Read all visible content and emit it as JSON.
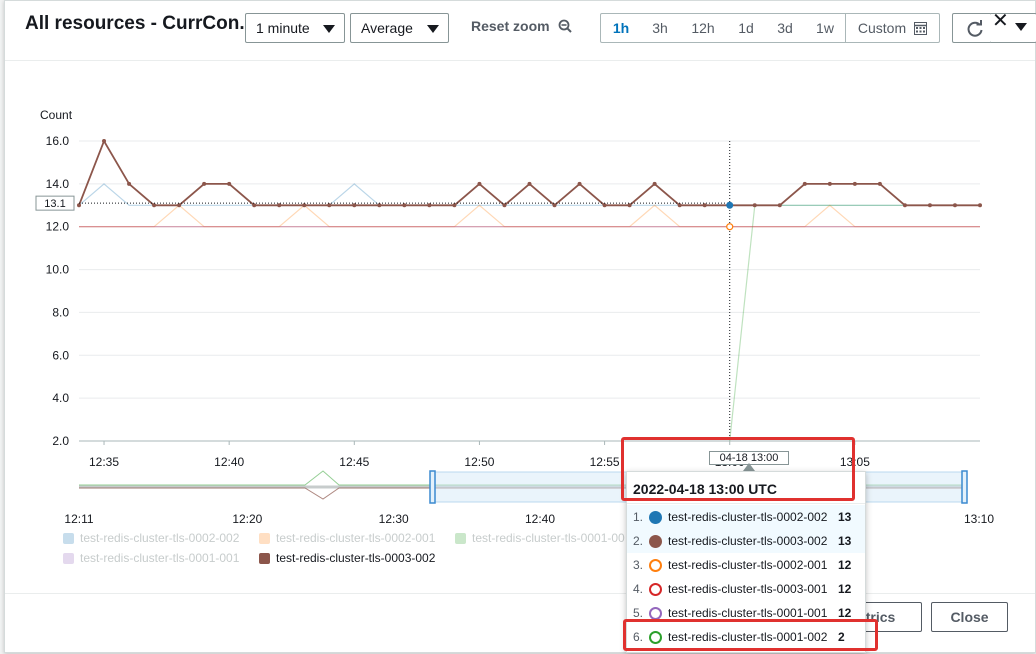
{
  "header": {
    "title": "All resources - CurrCon...",
    "period": "1 minute",
    "statistic": "Average",
    "reset_zoom": "Reset zoom",
    "ranges": [
      "1h",
      "3h",
      "12h",
      "1d",
      "3d",
      "1w"
    ],
    "selected_range": "1h",
    "custom": "Custom"
  },
  "footer": {
    "metrics_label": "trics",
    "close_label": "Close"
  },
  "legend": [
    {
      "name": "test-redis-cluster-tls-0002-002",
      "color": "#1f77b4",
      "active": false
    },
    {
      "name": "test-redis-cluster-tls-0002-001",
      "color": "#ff7f0e",
      "active": false
    },
    {
      "name": "test-redis-cluster-tls-0001-00",
      "color": "#2ca02c",
      "active": false
    },
    {
      "name": "test-redis-cluster-tls-0001-001",
      "color": "#9467bd",
      "active": false
    },
    {
      "name": "test-redis-cluster-tls-0003-002",
      "color": "#8c564b",
      "active": true
    }
  ],
  "tooltip": {
    "timestamp": "2022-04-18 13:00 UTC",
    "cursor_label": "04-18 13:00",
    "rows": [
      {
        "num": "1.",
        "name": "test-redis-cluster-tls-0002-002",
        "value": "13",
        "color": "#1f77b4",
        "filled": true
      },
      {
        "num": "2.",
        "name": "test-redis-cluster-tls-0003-002",
        "value": "13",
        "color": "#8c564b",
        "filled": true
      },
      {
        "num": "3.",
        "name": "test-redis-cluster-tls-0002-001",
        "value": "12",
        "color": "#ff7f0e",
        "filled": false
      },
      {
        "num": "4.",
        "name": "test-redis-cluster-tls-0003-001",
        "value": "12",
        "color": "#d62728",
        "filled": false
      },
      {
        "num": "5.",
        "name": "test-redis-cluster-tls-0001-001",
        "value": "12",
        "color": "#9467bd",
        "filled": false
      },
      {
        "num": "6.",
        "name": "test-redis-cluster-tls-0001-002",
        "value": "2",
        "color": "#2ca02c",
        "filled": false
      }
    ]
  },
  "chart_data": {
    "type": "line",
    "ylabel": "Count",
    "ylim": [
      2,
      16
    ],
    "yticks": [
      "16.0",
      "14.0",
      "12.0",
      "10.0",
      "8.0",
      "6.0",
      "4.0",
      "2.0"
    ],
    "xticks": [
      "12:35",
      "12:40",
      "12:45",
      "12:50",
      "12:55",
      "13:00",
      "13:05"
    ],
    "hover_value_label": "13.1",
    "overview_ticks": [
      "12:11",
      "12:20",
      "12:30",
      "12:40",
      "12:50",
      "13:00",
      "13:10"
    ],
    "x": [
      "12:34",
      "12:35",
      "12:36",
      "12:37",
      "12:38",
      "12:39",
      "12:40",
      "12:41",
      "12:42",
      "12:43",
      "12:44",
      "12:45",
      "12:46",
      "12:47",
      "12:48",
      "12:49",
      "12:50",
      "12:51",
      "12:52",
      "12:53",
      "12:54",
      "12:55",
      "12:56",
      "12:57",
      "12:58",
      "12:59",
      "13:00",
      "13:01",
      "13:02",
      "13:03",
      "13:04",
      "13:05",
      "13:06",
      "13:07",
      "13:08",
      "13:09",
      "13:10"
    ],
    "series": [
      {
        "name": "test-redis-cluster-tls-0003-002",
        "color": "#8c564b",
        "values": [
          13,
          16,
          14,
          13,
          13,
          14,
          14,
          13,
          13,
          13,
          13,
          13,
          13,
          13,
          13,
          13,
          14,
          13,
          14,
          13,
          14,
          13,
          13,
          14,
          13,
          13,
          13,
          13,
          13,
          14,
          14,
          14,
          14,
          13,
          13,
          13,
          13
        ]
      },
      {
        "name": "test-redis-cluster-tls-0002-002",
        "color": "#1f77b4",
        "values": [
          13,
          14,
          13,
          13,
          13,
          13,
          13,
          13,
          13,
          13,
          13,
          14,
          13,
          13,
          13,
          13,
          13,
          13,
          13,
          13,
          13,
          13,
          13,
          13,
          13,
          13,
          13,
          13,
          13,
          13,
          13,
          13,
          13,
          13,
          13,
          13,
          13
        ]
      },
      {
        "name": "test-redis-cluster-tls-0002-001",
        "color": "#ff7f0e",
        "values": [
          12,
          12,
          12,
          12,
          13,
          12,
          12,
          12,
          12,
          13,
          12,
          12,
          12,
          12,
          12,
          12,
          13,
          12,
          12,
          12,
          12,
          12,
          12,
          13,
          12,
          12,
          12,
          12,
          12,
          12,
          13,
          12,
          12,
          12,
          12,
          12,
          12
        ]
      },
      {
        "name": "test-redis-cluster-tls-0001-002",
        "color": "#2ca02c",
        "values": [
          null,
          null,
          null,
          null,
          null,
          null,
          null,
          null,
          null,
          null,
          null,
          null,
          null,
          null,
          null,
          null,
          null,
          null,
          null,
          null,
          null,
          null,
          null,
          null,
          null,
          null,
          2,
          13,
          13,
          13,
          13,
          13,
          13,
          13,
          13,
          13,
          13
        ]
      },
      {
        "name": "test-redis-cluster-tls-0001-001",
        "color": "#9467bd",
        "values": [
          12,
          12,
          12,
          12,
          12,
          12,
          12,
          12,
          12,
          12,
          12,
          12,
          12,
          12,
          12,
          12,
          12,
          12,
          12,
          12,
          12,
          12,
          12,
          12,
          12,
          12,
          12,
          12,
          12,
          12,
          12,
          12,
          12,
          12,
          12,
          12,
          12
        ]
      },
      {
        "name": "test-redis-cluster-tls-0003-001",
        "color": "#d62728",
        "values": [
          12,
          12,
          12,
          12,
          12,
          12,
          12,
          12,
          12,
          12,
          12,
          12,
          12,
          12,
          12,
          12,
          12,
          12,
          12,
          12,
          12,
          12,
          12,
          12,
          12,
          12,
          12,
          12,
          12,
          12,
          12,
          12,
          12,
          12,
          12,
          12,
          12
        ]
      }
    ]
  }
}
